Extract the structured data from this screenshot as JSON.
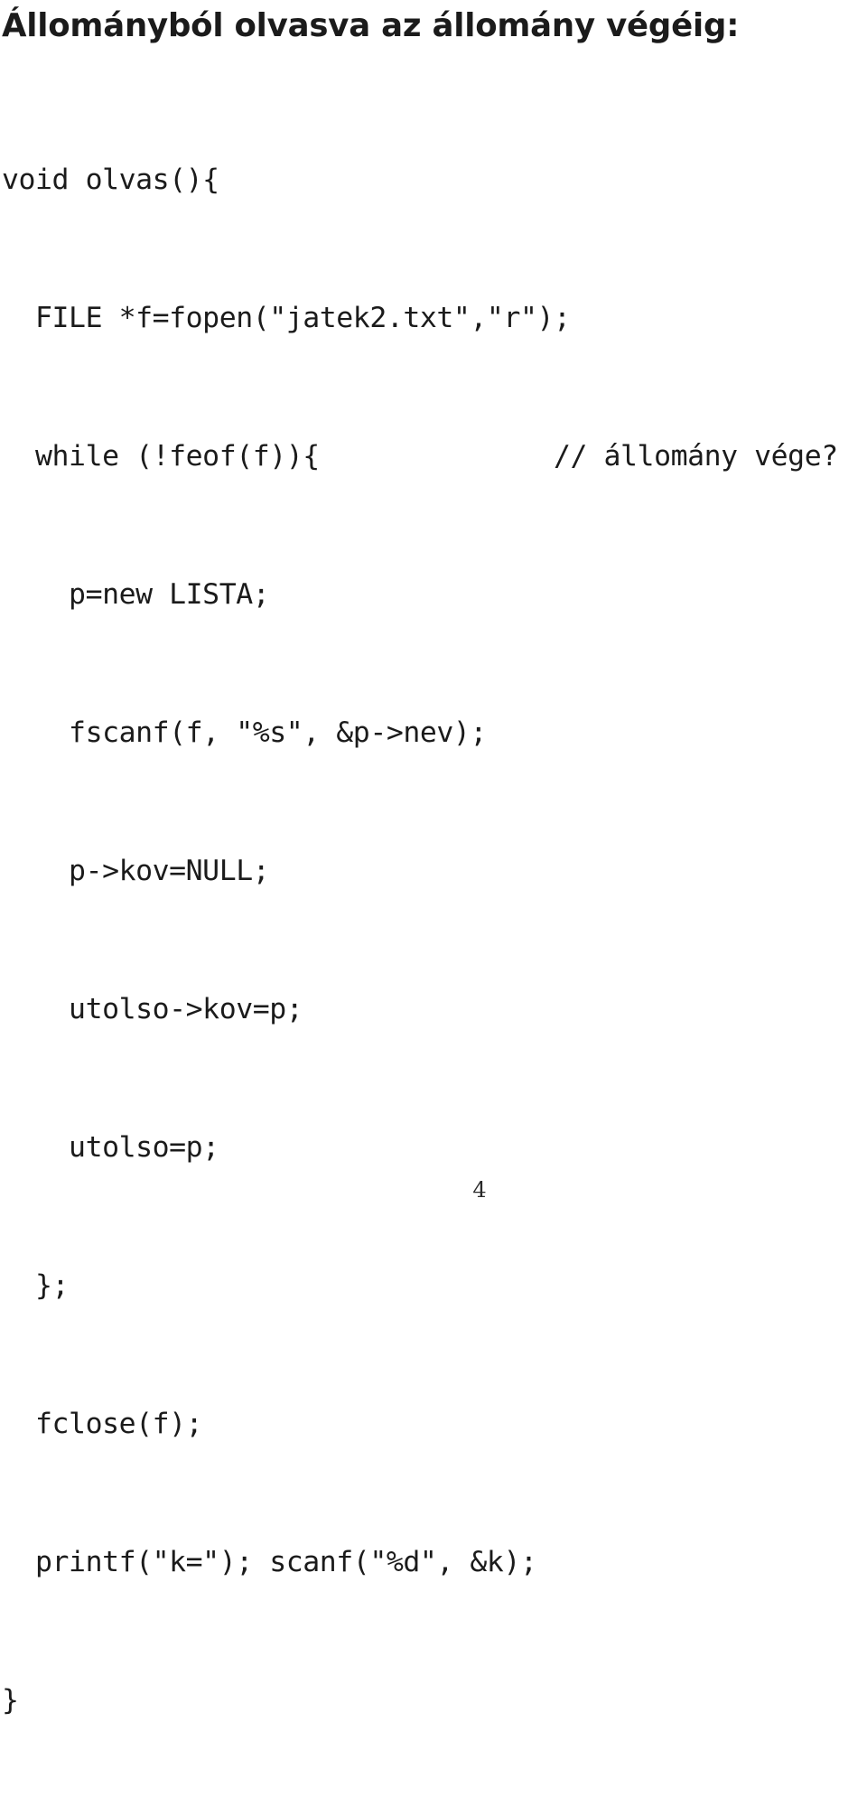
{
  "document": {
    "heading": "Állományból olvasva az állomány végéig:",
    "page_number": "4",
    "text_color": "#1b1b1b",
    "background_color": "#ffffff"
  },
  "code": {
    "language": "c",
    "lines": [
      "void olvas(){",
      "  FILE *f=fopen(\"jatek2.txt\",\"r\");",
      "  while (!feof(f)){              // állomány vége?",
      "    p=new LISTA;",
      "    fscanf(f, \"%s\", &p->nev);",
      "    p->kov=NULL;",
      "    utolso->kov=p;",
      "    utolso=p;",
      "  };",
      "  fclose(f);",
      "  printf(\"k=\"); scanf(\"%d\", &k);",
      "}"
    ]
  }
}
